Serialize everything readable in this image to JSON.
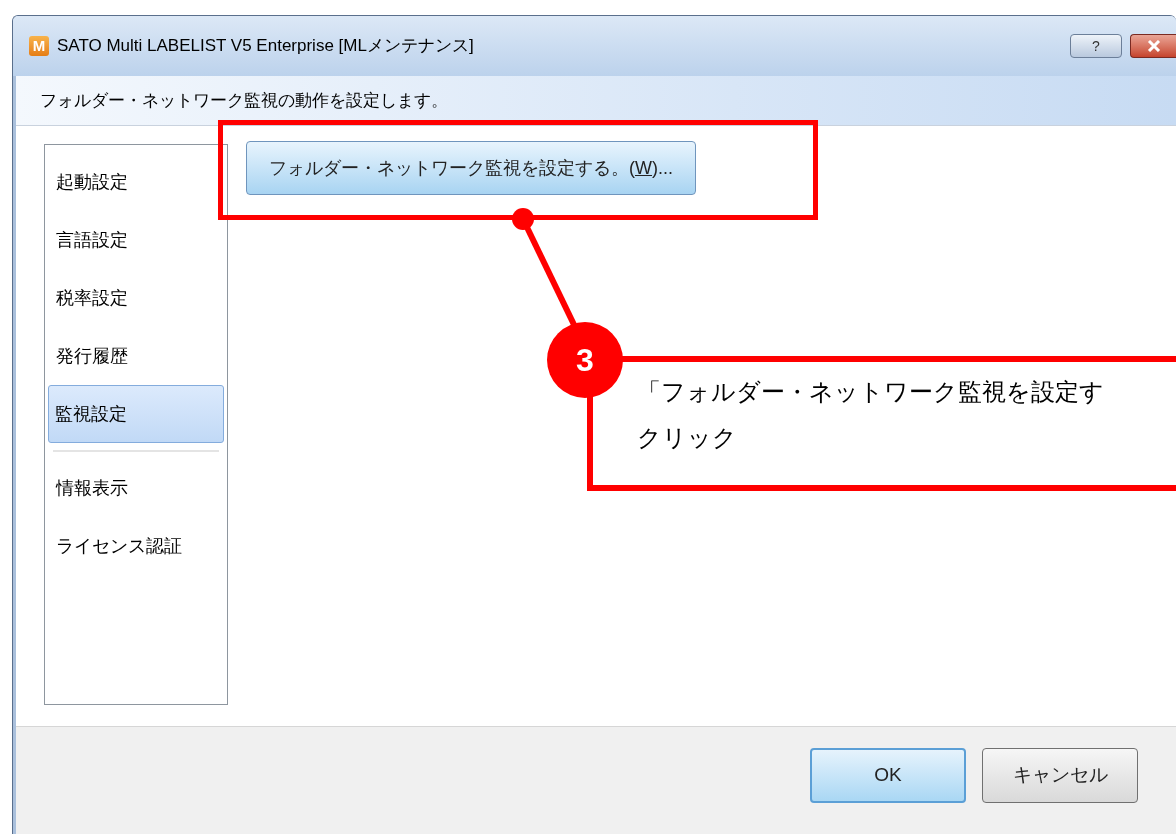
{
  "window": {
    "title": "SATO Multi LABELIST V5 Enterprise [MLメンテナンス]",
    "app_icon_letter": "M",
    "help_button": "?"
  },
  "description": "フォルダー・ネットワーク監視の動作を設定します。",
  "sidebar": {
    "sections": [
      {
        "items": [
          {
            "label": "起動設定",
            "selected": false
          },
          {
            "label": "言語設定",
            "selected": false
          },
          {
            "label": "税率設定",
            "selected": false
          },
          {
            "label": "発行履歴",
            "selected": false
          },
          {
            "label": "監視設定",
            "selected": true
          }
        ]
      },
      {
        "items": [
          {
            "label": "情報表示",
            "selected": false
          },
          {
            "label": "ライセンス認証",
            "selected": false
          }
        ]
      }
    ]
  },
  "action_button": {
    "label_before": "フォルダー・ネットワーク監視を設定する。(",
    "access_key": "W",
    "label_after": ")..."
  },
  "annotation": {
    "step": "3",
    "lines": [
      "「フォルダー・ネットワーク監視を設定す",
      "クリック"
    ]
  },
  "buttons": [
    {
      "label": "OK",
      "default": true
    },
    {
      "label": "キャンセル",
      "default": false
    }
  ]
}
